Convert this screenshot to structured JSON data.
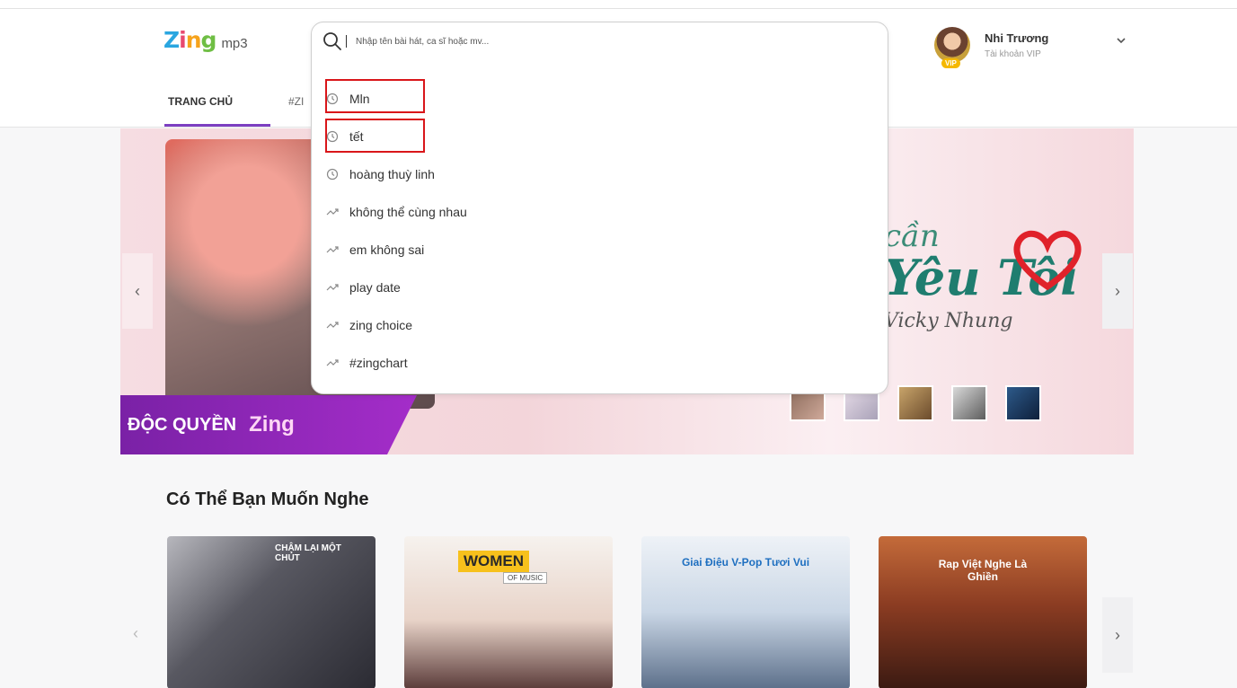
{
  "header": {
    "logo_text": "Zing",
    "logo_suffix": "mp3",
    "user": {
      "name": "Nhi Trương",
      "subtitle": "Tài khoản VIP",
      "badge": "VIP"
    }
  },
  "nav": {
    "items": [
      {
        "label": "TRANG CHỦ",
        "active": true
      },
      {
        "label": "#ZI"
      }
    ]
  },
  "search": {
    "placeholder": "Nhập tên bài hát, ca sĩ hoặc mv...",
    "suggestions": [
      {
        "type": "history",
        "icon": "clock-icon",
        "label": "Mln"
      },
      {
        "type": "history",
        "icon": "clock-icon",
        "label": "tết"
      },
      {
        "type": "history",
        "icon": "clock-icon",
        "label": "hoàng thuỳ linh"
      },
      {
        "type": "trending",
        "icon": "trending-icon",
        "label": "không thể cùng nhau"
      },
      {
        "type": "trending",
        "icon": "trending-icon",
        "label": "em không sai"
      },
      {
        "type": "trending",
        "icon": "trending-icon",
        "label": "play date"
      },
      {
        "type": "trending",
        "icon": "trending-icon",
        "label": "zing choice"
      },
      {
        "type": "trending",
        "icon": "trending-icon",
        "label": "#zingchart"
      }
    ]
  },
  "banner": {
    "ribbon_label": "ĐỘC QUYỀN",
    "ribbon_brand": "Zing",
    "art_line1": "cần",
    "art_line2": "Yêu Tôi",
    "art_line3": "Vicky Nhung",
    "arrow_left": "‹",
    "arrow_right": "›"
  },
  "section": {
    "title": "Có Thể Bạn Muốn Nghe",
    "cards": [
      {
        "title": "CHẬM LẠI MỘT CHÚT"
      },
      {
        "title": "WOMEN",
        "subtitle": "OF MUSIC"
      },
      {
        "title": "Giai Điệu V-Pop Tươi Vui"
      },
      {
        "title": "Rap Việt Nghe Là Ghiền"
      }
    ]
  },
  "colors": {
    "accent": "#7d3fc1",
    "highlight": "#d9161a",
    "logo": [
      "#2aa6e0",
      "#e8496f",
      "#f6a31c",
      "#6fbe44"
    ]
  }
}
